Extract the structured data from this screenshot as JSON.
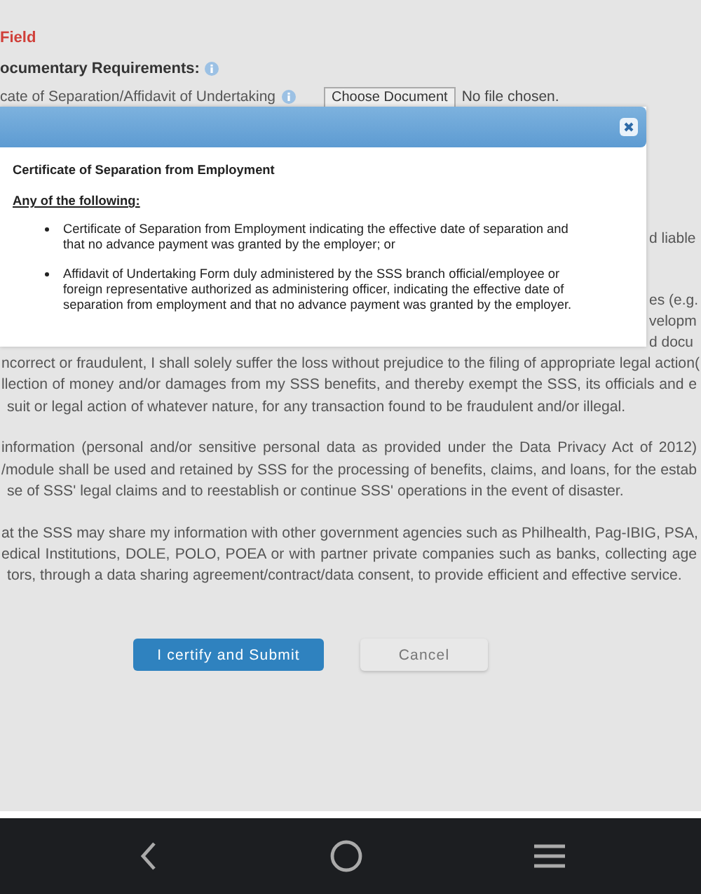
{
  "page": {
    "required_note": "Field",
    "requirements_label": "ocumentary Requirements:",
    "upload": {
      "label": "cate of Separation/Affidavit of Undertaking",
      "button": "Choose Document",
      "status": "No file chosen."
    },
    "covered_fragments": [
      "d liable",
      "es (e.g.",
      "velopm",
      "d docu"
    ],
    "paragraphs": [
      [
        "ncorrect or fraudulent, I shall solely suffer the loss without prejudice to the filing of appropriate legal action(",
        "llection of money and/or damages from my SSS benefits, and thereby exempt the SSS, its officials and e",
        "suit or legal action of whatever nature, for any transaction found to be fraudulent and/or illegal."
      ],
      [
        "information (personal and/or sensitive personal data as provided under the Data Privacy Act of 2012)",
        "/module shall be used and retained by SSS for the processing of benefits, claims, and loans, for the estab",
        "se of SSS' legal claims and to reestablish or continue SSS' operations in the event of disaster."
      ],
      [
        "at the SSS may share my information with other government agencies such as Philhealth, Pag-IBIG, PSA,",
        "edical Institutions, DOLE, POLO, POEA or with partner private companies such as banks, collecting age",
        "tors, through a data sharing agreement/contract/data consent, to provide efficient and effective service."
      ]
    ],
    "buttons": [
      {
        "label": "I certify and Submit",
        "kind": "primary"
      },
      {
        "label": "Cancel",
        "kind": "secondary"
      }
    ]
  },
  "modal": {
    "title": "Certificate of Separation from Employment",
    "subtitle": "Any of the following:",
    "items": [
      "Certificate of Separation from Employment indicating the effective date of separation and that no advance payment was granted by the employer; or",
      "Affidavit of Undertaking Form duly administered by the SSS branch official/employee or foreign representative authorized as administering officer, indicating the effective date of separation from employment and that no advance payment was granted by the employer."
    ]
  }
}
